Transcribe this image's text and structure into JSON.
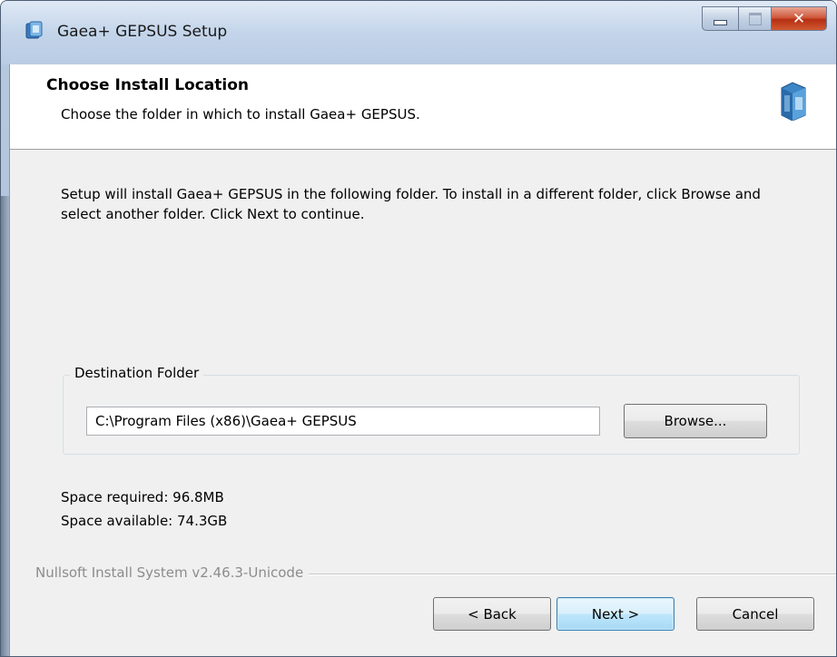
{
  "window": {
    "title": "Gaea+ GEPSUS Setup",
    "accent_close": "#c9472a"
  },
  "header": {
    "title": "Choose Install Location",
    "subtitle": "Choose the folder in which to install Gaea+ GEPSUS."
  },
  "body": {
    "description": "Setup will install Gaea+ GEPSUS in the following folder. To install in a different folder, click Browse and select another folder. Click Next to continue.",
    "destination_label": "Destination Folder",
    "destination_path": "C:\\Program Files (x86)\\Gaea+ GEPSUS",
    "browse_label": "Browse...",
    "space_required": "Space required: 96.8MB",
    "space_available": "Space available: 74.3GB"
  },
  "footer": {
    "branding": "Nullsoft Install System v2.46.3-Unicode",
    "back_label": "< Back",
    "next_label": "Next >",
    "cancel_label": "Cancel"
  },
  "icons": {
    "app": "installer-icon",
    "header": "installer-box-icon",
    "minimize": "minimize-icon",
    "maximize": "maximize-icon",
    "close": "close-icon"
  }
}
